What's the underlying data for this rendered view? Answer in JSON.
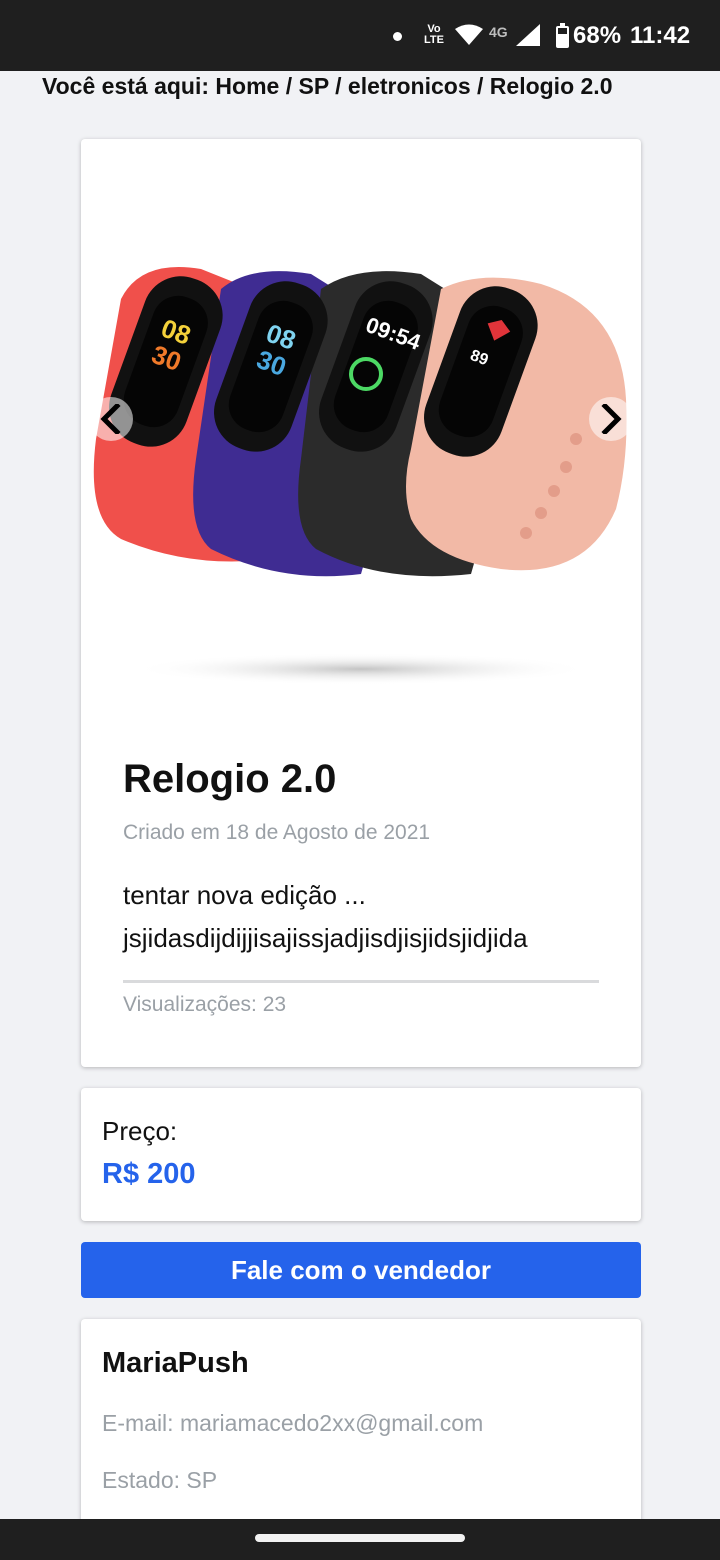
{
  "status_bar": {
    "volte": "Vo LTE",
    "network": "4G",
    "battery": "68%",
    "time": "11:42"
  },
  "breadcrumb": "Você está aqui: Home / SP / eletronicos / Relogio 2.0",
  "product": {
    "title": "Relogio 2.0",
    "created": "Criado em 18 de Agosto de 2021",
    "description": "tentar nova edição ... jsjidasdijdijjisajissjadjisdjisjidsjidjida",
    "views": "Visualizações: 23",
    "watch_screens": [
      "08 30",
      "08 30",
      "09:54",
      "89"
    ]
  },
  "price": {
    "label": "Preço:",
    "value": "R$ 200"
  },
  "contact_button": "Fale com o vendedor",
  "seller": {
    "name": "MariaPush",
    "email": "E-mail: mariamacedo2xx@gmail.com",
    "state": "Estado: SP"
  },
  "colors": {
    "accent": "#2563eb",
    "muted_text": "#9aa0a6",
    "background": "#f1f2f5",
    "system_bar": "#1f1f1f",
    "band_red": "#f0504b",
    "band_purple": "#3f2c92",
    "band_black": "#2b2b2b",
    "band_pink": "#f2b9a6"
  },
  "icons": {
    "prev": "chevron-left-icon",
    "next": "chevron-right-icon",
    "wifi": "wifi-icon",
    "signal": "signal-icon",
    "battery": "battery-icon"
  }
}
